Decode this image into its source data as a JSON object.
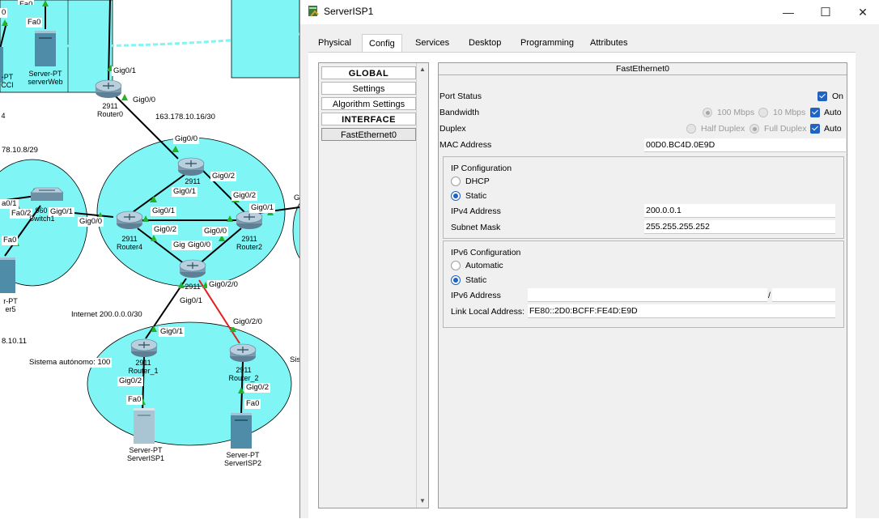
{
  "window": {
    "title": "ServerISP1",
    "minimize_glyph": "—",
    "maximize_glyph": "☐",
    "close_glyph": "✕"
  },
  "tabs": [
    {
      "label": "Physical"
    },
    {
      "label": "Config",
      "active": true
    },
    {
      "label": "Services"
    },
    {
      "label": "Desktop"
    },
    {
      "label": "Programming"
    },
    {
      "label": "Attributes"
    }
  ],
  "nav": {
    "global_header": "GLOBAL",
    "settings": "Settings",
    "algorithm_settings": "Algorithm Settings",
    "interface_header": "INTERFACE",
    "fast_ethernet": "FastEthernet0"
  },
  "config": {
    "header": "FastEthernet0",
    "port_status_label": "Port Status",
    "port_status_on": "On",
    "bandwidth_label": "Bandwidth",
    "bw_100": "100 Mbps",
    "bw_10": "10 Mbps",
    "bw_auto": "Auto",
    "duplex_label": "Duplex",
    "half_duplex": "Half Duplex",
    "full_duplex": "Full Duplex",
    "duplex_auto": "Auto",
    "mac_label": "MAC Address",
    "mac_value": "00D0.BC4D.0E9D",
    "ip_config_title": "IP Configuration",
    "dhcp": "DHCP",
    "static": "Static",
    "ipv4_label": "IPv4 Address",
    "ipv4_value": "200.0.0.1",
    "subnet_label": "Subnet Mask",
    "subnet_value": "255.255.255.252",
    "ipv6_config_title": "IPv6 Configuration",
    "automatic": "Automatic",
    "static6": "Static",
    "ipv6_label": "IPv6 Address",
    "ipv6_value": "",
    "ipv6_slash": "/",
    "prefix_value": "",
    "link_local_label": "Link Local Address:",
    "link_local_value": "FE80::2D0:BCFF:FE4D:E9D"
  },
  "colors": {
    "cloud": "#7ff5f5",
    "link": "#000000",
    "link_down": "#e02020",
    "link_up_marker": "#22b422",
    "accent": "#1f63c6"
  },
  "topology": {
    "labels": [
      {
        "id": "fa0-top",
        "text": "Fa0"
      },
      {
        "id": "gig01-r0",
        "text": "Gig0/1"
      },
      {
        "id": "gig00-r0",
        "text": "Gig0/0"
      },
      {
        "id": "net-16",
        "text": "163.178.10.16/30"
      },
      {
        "id": "gig00-r1",
        "text": "Gig0/0"
      },
      {
        "id": "net-8",
        "text": "78.10.8/29"
      },
      {
        "id": "gig02-r1",
        "text": "Gig0/2"
      },
      {
        "id": "gig01-r1",
        "text": "Gig0/1"
      },
      {
        "id": "gig02-r2",
        "text": "Gig0/2"
      },
      {
        "id": "gig01-r2",
        "text": "Gig0/1"
      },
      {
        "id": "g-edge",
        "text": "G"
      },
      {
        "id": "a01",
        "text": "a0/1"
      },
      {
        "id": "fa02",
        "text": "Fa0/2"
      },
      {
        "id": "gig01-sw",
        "text": "Gig0/1"
      },
      {
        "id": "gig00-r4",
        "text": "Gig0/0"
      },
      {
        "id": "gig01-r4",
        "text": "Gig0/1"
      },
      {
        "id": "gig02-r4",
        "text": "Gig0/2"
      },
      {
        "id": "gig00-r2",
        "text": "Gig0/0"
      },
      {
        "id": "gig-r3",
        "text": "Gig"
      },
      {
        "id": "gig00-r3",
        "text": "Gig0/0"
      },
      {
        "id": "fa0-left",
        "text": "Fa0"
      },
      {
        "id": "gig020-r3",
        "text": "Gig0/2/0"
      },
      {
        "id": "gig01-r3",
        "text": "Gig0/1"
      },
      {
        "id": "internet",
        "text": "Internet 200.0.0.0/30"
      },
      {
        "id": "gig020-r5",
        "text": "Gig0/2/0"
      },
      {
        "id": "gig01-r5",
        "text": "Gig0/1"
      },
      {
        "id": "net-11",
        "text": "8.10.11"
      },
      {
        "id": "as100",
        "text": "Sistema autónomo: 100"
      },
      {
        "id": "sis",
        "text": "Sis"
      },
      {
        "id": "gig02-r5",
        "text": "Gig0/2"
      },
      {
        "id": "gig02-r6",
        "text": "Gig0/2"
      },
      {
        "id": "fa0-isp1",
        "text": "Fa0"
      },
      {
        "id": "fa0-isp2",
        "text": "Fa0"
      },
      {
        "id": "num0",
        "text": "0"
      }
    ],
    "captions": [
      {
        "id": "cap-r0",
        "line1": "2911",
        "line2": "Router0"
      },
      {
        "id": "cap-r1",
        "line1": "2911",
        "line2": ""
      },
      {
        "id": "cap-r4",
        "line1": "2911",
        "line2": "Router4"
      },
      {
        "id": "cap-r2",
        "line1": "2911",
        "line2": "Router2"
      },
      {
        "id": "cap-r3",
        "line1": "2911",
        "line2": ""
      },
      {
        "id": "cap-r5",
        "line1": "2911",
        "line2": "Router_1"
      },
      {
        "id": "cap-r6",
        "line1": "2911",
        "line2": "Router_2"
      },
      {
        "id": "cap-sw",
        "line1": "960",
        "line2": "Switch1"
      },
      {
        "id": "cap-web",
        "line1": "Server-PT",
        "line2": "serverWeb"
      },
      {
        "id": "cap-pt",
        "line1": "-PT",
        "line2": "CCI"
      },
      {
        "id": "cap-s5",
        "line1": "r-PT",
        "line2": "er5"
      },
      {
        "id": "cap-isp1",
        "line1": "Server-PT",
        "line2": "ServerISP1"
      },
      {
        "id": "cap-isp2",
        "line1": "Server-PT",
        "line2": "ServerISP2"
      },
      {
        "id": "cap-4",
        "line1": "4",
        "line2": ""
      }
    ]
  }
}
